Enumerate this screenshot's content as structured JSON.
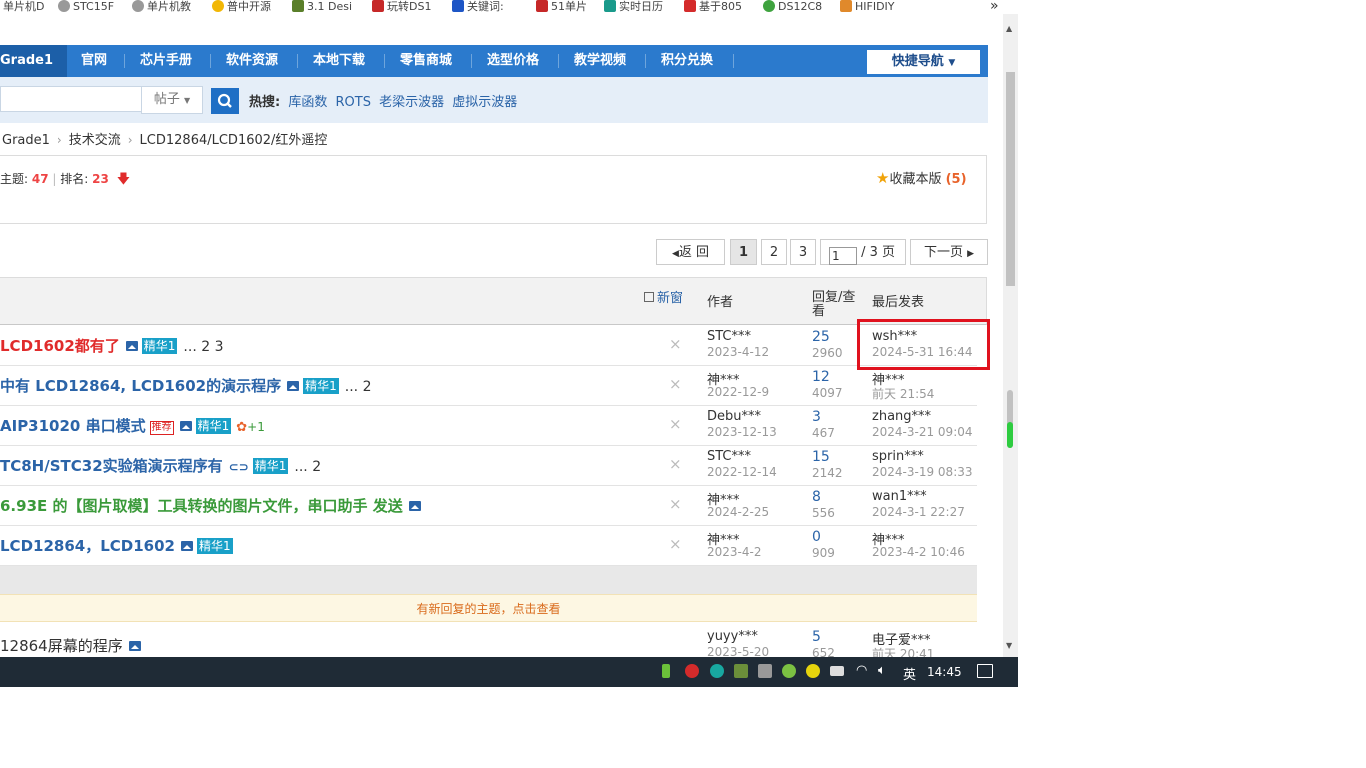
{
  "bookmarks": [
    {
      "label": "单片机D",
      "color": "#888"
    },
    {
      "label": "STC15F",
      "color": "#888"
    },
    {
      "label": "单片机教",
      "color": "#888"
    },
    {
      "label": "普中开源",
      "color": "#f2b705"
    },
    {
      "label": "3.1 Desi",
      "color": "#5a7f2a"
    },
    {
      "label": "玩转DS1",
      "color": "#c62828"
    },
    {
      "label": "关键词:",
      "color": "#1e56c6"
    },
    {
      "label": "51单片",
      "color": "#c62828"
    },
    {
      "label": "实时日历",
      "color": "#1a9a8b"
    },
    {
      "label": "基于805",
      "color": "#d42b2b"
    },
    {
      "label": "DS12C8",
      "color": "#3fa33f"
    },
    {
      "label": "HIFIDIY",
      "color": "#e0892b"
    }
  ],
  "bookmarks_more": "»",
  "nav": {
    "grade": "Grade1",
    "items": [
      "官网",
      "芯片手册",
      "软件资源",
      "本地下载",
      "零售商城",
      "选型价格",
      "教学视频",
      "积分兑换"
    ],
    "quick": "快捷导航"
  },
  "search": {
    "type": "帖子",
    "hot_label": "热搜:",
    "hot": [
      "库函数",
      "ROTS",
      "老梁示波器",
      "虚拟示波器"
    ]
  },
  "breadcrumb": [
    "Grade1",
    "技术交流",
    "LCD12864/LCD1602/红外遥控"
  ],
  "forum": {
    "topics_label": "主题:",
    "topics": "47",
    "rank_label": "排名:",
    "rank": "23",
    "fav_label": "收藏本版",
    "fav_count": "(5)"
  },
  "pager": {
    "back": "返 回",
    "pages": [
      "1",
      "2",
      "3"
    ],
    "jump_value": "1",
    "jump_total": "/ 3 页",
    "next": "下一页"
  },
  "table": {
    "new_window": "新窗",
    "col_author": "作者",
    "col_reply": "回复/查看",
    "col_last": "最后发表"
  },
  "rows": [
    {
      "title": "LCD1602都有了",
      "color": "#e02b2b",
      "pages": "... 2  3",
      "badge": "精华1",
      "author": "STC***",
      "date": "2023-4-12",
      "replies": "25",
      "views": "2960",
      "last_user": "wsh***",
      "last_date": "2024-5-31 16:44"
    },
    {
      "title": "中有 LCD12864, LCD1602的演示程序",
      "color": "#2b64a8",
      "pages": "... 2",
      "badge": "精华1",
      "author": "神***",
      "date": "2022-12-9",
      "replies": "12",
      "views": "4097",
      "last_user": "神***",
      "last_date": "前天 21:54"
    },
    {
      "title": "AIP31020 串口模式",
      "color": "#2b64a8",
      "pages": "",
      "badge": "精华1",
      "extra": "+1",
      "author": "Debu***",
      "date": "2023-12-13",
      "replies": "3",
      "views": "467",
      "last_user": "zhang***",
      "last_date": "2024-3-21 09:04"
    },
    {
      "title": "TC8H/STC32实验箱演示程序有",
      "color": "#2b64a8",
      "pages": "... 2",
      "badge": "精华1",
      "author": "STC***",
      "date": "2022-12-14",
      "replies": "15",
      "views": "2142",
      "last_user": "sprin***",
      "last_date": "2024-3-19 08:33"
    },
    {
      "title": "6.93E 的【图片取模】工具转换的图片文件，串口助手 发送",
      "color": "#3a9a3a",
      "pages": "",
      "badge": "",
      "author": "神***",
      "date": "2024-2-25",
      "replies": "8",
      "views": "556",
      "last_user": "wan1***",
      "last_date": "2024-3-1 22:27"
    },
    {
      "title": "LCD12864，LCD1602",
      "color": "#2b64a8",
      "pages": "",
      "badge": "精华1",
      "author": "神***",
      "date": "2023-4-2",
      "replies": "0",
      "views": "909",
      "last_user": "神***",
      "last_date": "2023-4-2 10:46"
    }
  ],
  "rec_badge": "推荐",
  "new_reply_notice": "有新回复的主题，点击查看",
  "last_row": {
    "title": "12864屏幕的程序",
    "author": "yuyy***",
    "date": "2023-5-20",
    "replies": "5",
    "views": "652",
    "last_user": "电子爱***",
    "last_date": "前天 20:41"
  },
  "taskbar": {
    "ime": "英",
    "time": "14:45"
  }
}
